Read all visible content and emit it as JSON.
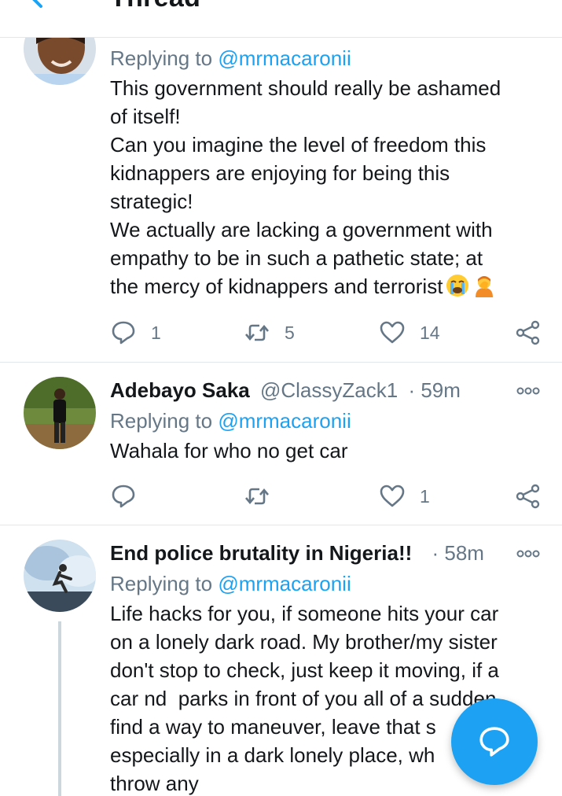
{
  "header": {
    "title": "Thread"
  },
  "tweets": [
    {
      "replying_prefix": "Replying to",
      "replying_to": "@mrmacaronii",
      "lines": [
        "This government should really be ashamed",
        "of itself!",
        "Can you imagine the level of freedom this",
        "kidnappers are enjoying for being this",
        "strategic!",
        "We actually are lacking a government with",
        "empathy to be in such a pathetic state; at",
        "the mercy of kidnappers and terrorist"
      ],
      "emojis": [
        "loudly-crying-face",
        "person-facepalming"
      ],
      "replies": "1",
      "retweets": "5",
      "likes": "14"
    },
    {
      "name": "Adebayo Saka",
      "handle": "@ClassyZack1",
      "time": "· 59m",
      "replying_prefix": "Replying to",
      "replying_to": "@mrmacaronii",
      "lines": [
        "Wahala for who no get car"
      ],
      "replies": "",
      "retweets": "",
      "likes": "1"
    },
    {
      "name": "End police brutality in Nigeria!!",
      "handle": "",
      "time": "· 58m",
      "replying_prefix": "Replying to",
      "replying_to": "@mrmacaronii",
      "lines": [
        "Life hacks for you, if someone hits your car",
        "on a lonely dark road. My brother/my sister",
        "don't stop to check, just keep it moving, if a",
        "car nd  parks in front of you all of a sudden,",
        "find a way to maneuver, leave that s",
        "especially in a dark lonely place, wh",
        "throw any"
      ]
    }
  ],
  "colors": {
    "accent": "#1da1f2",
    "secondary_text": "#657786",
    "divider": "#e1e8ed"
  },
  "icons": {
    "back": "back-arrow-icon",
    "reply": "reply-icon",
    "retweet": "retweet-icon",
    "like": "heart-icon",
    "share": "share-icon",
    "more": "more-icon",
    "compose": "compose-reply-icon"
  }
}
